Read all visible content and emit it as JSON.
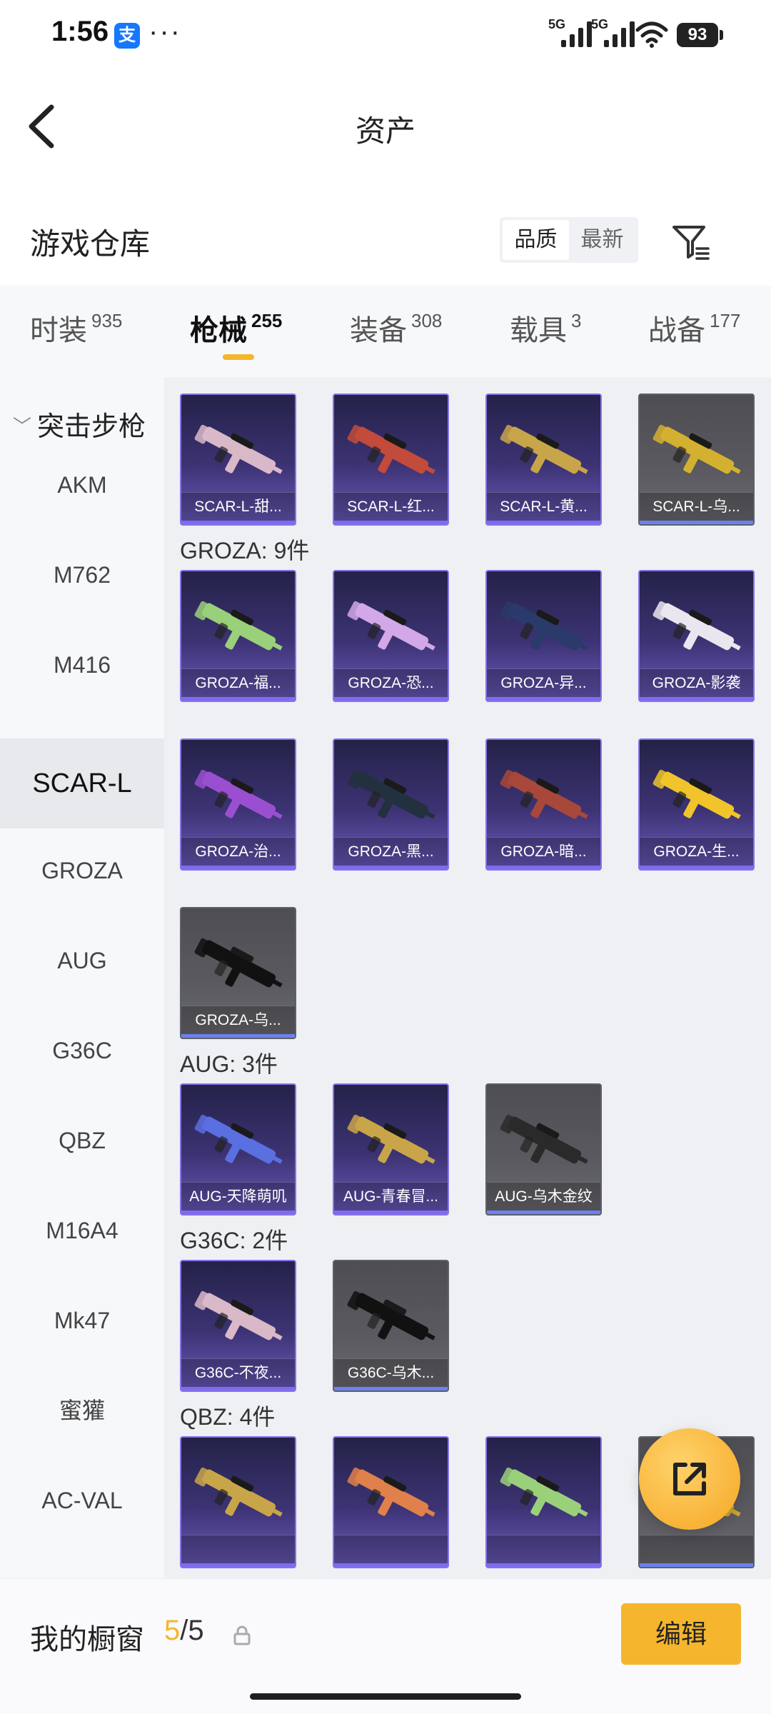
{
  "status_bar": {
    "time": "1:56",
    "app_badge": "支",
    "more": "···",
    "net1": "5G",
    "net2": "5G",
    "battery": "93"
  },
  "header": {
    "title": "资产"
  },
  "warehouse": {
    "title": "游戏仓库",
    "sort_options": [
      "品质",
      "最新"
    ],
    "active_sort": "品质"
  },
  "tabs": [
    {
      "name": "时装",
      "count": "935"
    },
    {
      "name": "枪械",
      "count": "255",
      "active": true
    },
    {
      "name": "装备",
      "count": "308"
    },
    {
      "name": "载具",
      "count": "3"
    },
    {
      "name": "战备",
      "count": "177"
    }
  ],
  "sidebar": {
    "header": "突击步枪",
    "items": [
      "AKM",
      "M762",
      "M416",
      "SCAR-L",
      "GROZA",
      "AUG",
      "G36C",
      "QBZ",
      "M16A4",
      "Mk47",
      "蜜獾",
      "AC-VAL"
    ],
    "active": "SCAR-L"
  },
  "groups": [
    {
      "label": "",
      "items": [
        {
          "name": "SCAR-L-甜...",
          "rarity": "purple"
        },
        {
          "name": "SCAR-L-红...",
          "rarity": "purple"
        },
        {
          "name": "SCAR-L-黄...",
          "rarity": "purple"
        },
        {
          "name": "SCAR-L-乌...",
          "rarity": "grey"
        }
      ]
    },
    {
      "label": "GROZA: 9件",
      "items": [
        {
          "name": "GROZA-福...",
          "rarity": "purple"
        },
        {
          "name": "GROZA-恐...",
          "rarity": "purple"
        },
        {
          "name": "GROZA-异...",
          "rarity": "purple"
        },
        {
          "name": "GROZA-影袭",
          "rarity": "purple"
        },
        {
          "name": "GROZA-治...",
          "rarity": "purple"
        },
        {
          "name": "GROZA-黑...",
          "rarity": "purple"
        },
        {
          "name": "GROZA-暗...",
          "rarity": "purple"
        },
        {
          "name": "GROZA-生...",
          "rarity": "purple"
        },
        {
          "name": "GROZA-乌...",
          "rarity": "grey"
        }
      ]
    },
    {
      "label": "AUG: 3件",
      "items": [
        {
          "name": "AUG-天降萌叽",
          "rarity": "purple"
        },
        {
          "name": "AUG-青春冒...",
          "rarity": "purple"
        },
        {
          "name": "AUG-乌木金纹",
          "rarity": "grey"
        }
      ]
    },
    {
      "label": "G36C: 2件",
      "items": [
        {
          "name": "G36C-不夜...",
          "rarity": "purple"
        },
        {
          "name": "G36C-乌木...",
          "rarity": "grey"
        }
      ]
    },
    {
      "label": "QBZ: 4件",
      "items": [
        {
          "name": "",
          "rarity": "purple"
        },
        {
          "name": "",
          "rarity": "purple"
        },
        {
          "name": "",
          "rarity": "purple"
        },
        {
          "name": "",
          "rarity": "grey"
        }
      ]
    }
  ],
  "showcase": {
    "title": "我的橱窗",
    "current": "5",
    "separator": "/",
    "total": "5",
    "edit_label": "编辑"
  },
  "colors": {
    "accent": "#f5b62d",
    "purple_rarity": "#7d6cf0",
    "grey_rarity": "#6b82f0"
  },
  "icons": {
    "back": "back-arrow-icon",
    "filter": "filter-icon",
    "share": "share-icon",
    "lock": "lock-icon"
  }
}
